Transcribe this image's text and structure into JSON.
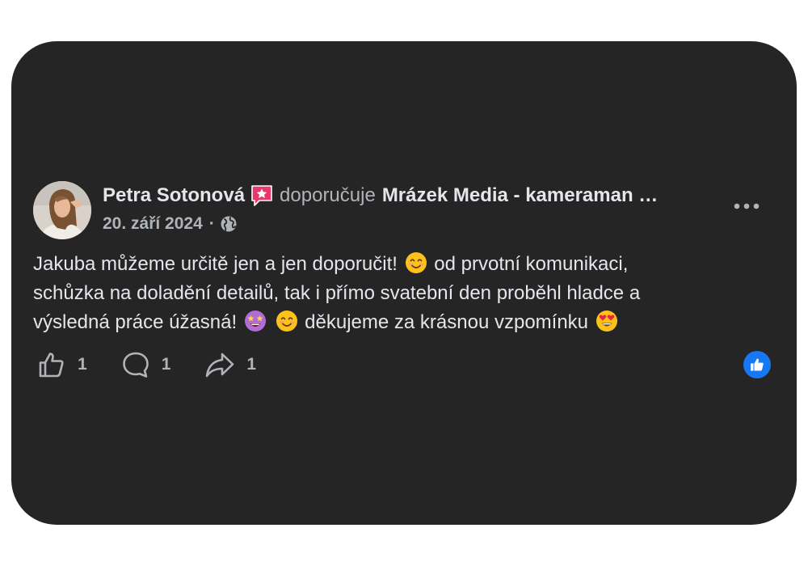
{
  "post": {
    "author": "Petra Sotonová",
    "recommends": "doporučuje",
    "page": "Mrázek Media - kameraman …",
    "date": "20. září 2024",
    "separator": "·",
    "privacy_icon": "globe-icon",
    "text": {
      "line1_a": "Jakuba můžeme určitě jen a jen doporučit!",
      "line1_b": "od prvotní komunikaci,",
      "line2": "schůzka na doladění detailů, tak i přímo svatební den proběhl hladce a",
      "line3_a": "výsledná práce úžasná!",
      "line3_b": "děkujeme za krásnou vzpomínku"
    },
    "emojis": [
      "smiling-face-emoji",
      "star-struck-emoji",
      "smiling-face-emoji",
      "heart-eyes-emoji"
    ]
  },
  "actions": {
    "like_count": "1",
    "comment_count": "1",
    "share_count": "1"
  },
  "reactions": {
    "icon": "like-reaction-icon",
    "color": "#1877f2"
  },
  "theme": {
    "card_bg": "#252526",
    "text": "#e4e6eb",
    "muted": "#b0b3b8",
    "badge": "#e6386b"
  }
}
